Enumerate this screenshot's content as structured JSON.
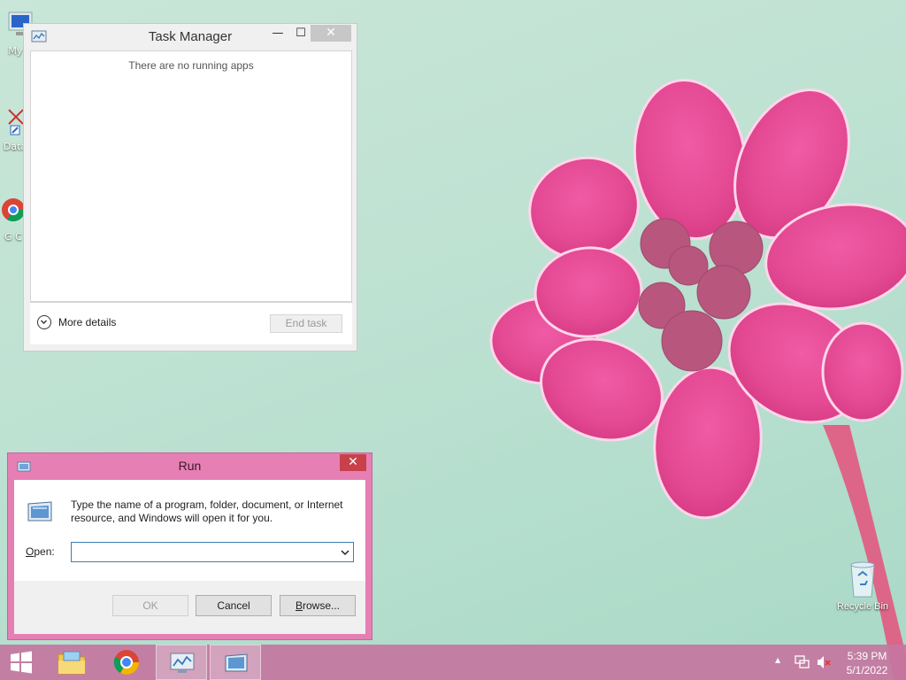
{
  "colors": {
    "desktop_bg": "#bfe2d3",
    "flower": "#e44a93",
    "run_frame": "#e67fb4",
    "taskbar": "#c476a0",
    "close_red": "#c8414a",
    "focus_blue": "#3c7fb1"
  },
  "desktop": {
    "icons": [
      {
        "label": "My C",
        "icon": "computer-icon"
      },
      {
        "label": "Data",
        "icon": "shortcut-icon"
      },
      {
        "label": "G C",
        "icon": "chrome-shortcut-icon"
      }
    ],
    "recycle_bin": {
      "label": "Recycle Bin",
      "icon": "recycle-bin-icon"
    }
  },
  "task_manager": {
    "title": "Task Manager",
    "minimize_glyph": "—",
    "maximize_glyph": "☐",
    "close_glyph": "✕",
    "empty_message": "There are no running apps",
    "more_details_label": "More details",
    "end_task_label": "End task"
  },
  "run_dialog": {
    "title": "Run",
    "close_glyph": "✕",
    "description": "Type the name of a program, folder, document, or Internet resource, and Windows will open it for you.",
    "open_label_accel": "O",
    "open_label_rest": "pen:",
    "open_value": "",
    "ok_label": "OK",
    "cancel_label": "Cancel",
    "browse_label_accel": "B",
    "browse_label_rest": "rowse..."
  },
  "taskbar": {
    "items": [
      {
        "name": "start",
        "icon": "windows-logo-icon",
        "active": false
      },
      {
        "name": "file-explorer",
        "icon": "folder-icon",
        "active": false
      },
      {
        "name": "chrome",
        "icon": "chrome-icon",
        "active": false
      },
      {
        "name": "task-manager",
        "icon": "task-manager-icon",
        "active": true
      },
      {
        "name": "run",
        "icon": "run-icon",
        "active": true
      }
    ],
    "tray": {
      "show_hidden_glyph": "▲",
      "time": "5:39 PM",
      "date": "5/1/2022"
    }
  }
}
